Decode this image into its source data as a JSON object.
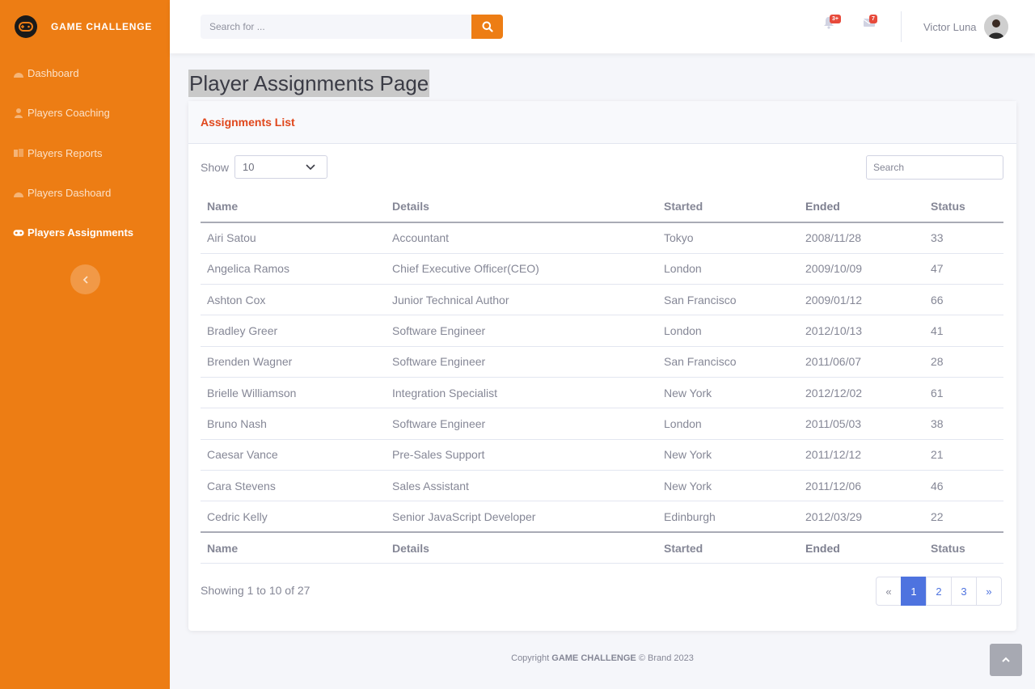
{
  "brand": {
    "name": "GAME CHALLENGE"
  },
  "sidebar": {
    "items": [
      {
        "label": "Dashboard",
        "icon": "dashboard-icon"
      },
      {
        "label": "Players Coaching",
        "icon": "user-icon"
      },
      {
        "label": "Players Reports",
        "icon": "report-icon"
      },
      {
        "label": "Players Dashoard",
        "icon": "dashboard-icon"
      },
      {
        "label": "Players Assignments",
        "icon": "gamepad-icon",
        "active": true
      }
    ]
  },
  "topbar": {
    "search_placeholder": "Search for ...",
    "alerts_badge": "3+",
    "messages_badge": "7",
    "user_name": "Victor Luna"
  },
  "page": {
    "title": "Player Assignments Page"
  },
  "card": {
    "header": "Assignments List",
    "show_label": "Show",
    "show_value": "10",
    "search_placeholder": "Search",
    "columns": [
      "Name",
      "Details",
      "Started",
      "Ended",
      "Status"
    ],
    "rows": [
      [
        "Airi Satou",
        "Accountant",
        "Tokyo",
        "2008/11/28",
        "33"
      ],
      [
        "Angelica Ramos",
        "Chief Executive Officer(CEO)",
        "London",
        "2009/10/09",
        "47"
      ],
      [
        "Ashton Cox",
        "Junior Technical Author",
        "San Francisco",
        "2009/01/12",
        "66"
      ],
      [
        "Bradley Greer",
        "Software Engineer",
        "London",
        "2012/10/13",
        "41"
      ],
      [
        "Brenden Wagner",
        "Software Engineer",
        "San Francisco",
        "2011/06/07",
        "28"
      ],
      [
        "Brielle Williamson",
        "Integration Specialist",
        "New York",
        "2012/12/02",
        "61"
      ],
      [
        "Bruno Nash",
        "Software Engineer",
        "London",
        "2011/05/03",
        "38"
      ],
      [
        "Caesar Vance",
        "Pre-Sales Support",
        "New York",
        "2011/12/12",
        "21"
      ],
      [
        "Cara Stevens",
        "Sales Assistant",
        "New York",
        "2011/12/06",
        "46"
      ],
      [
        "Cedric Kelly",
        "Senior JavaScript Developer",
        "Edinburgh",
        "2012/03/29",
        "22"
      ]
    ],
    "info": "Showing 1 to 10 of 27",
    "pagination": [
      "«",
      "1",
      "2",
      "3",
      "»"
    ]
  },
  "footer": {
    "prefix": "Copyright",
    "brand": "GAME CHALLENGE",
    "suffix": "© Brand 2023"
  },
  "colors": {
    "accent": "#ed7d14",
    "header_text": "#e0471c",
    "page_active": "#4e73df"
  }
}
